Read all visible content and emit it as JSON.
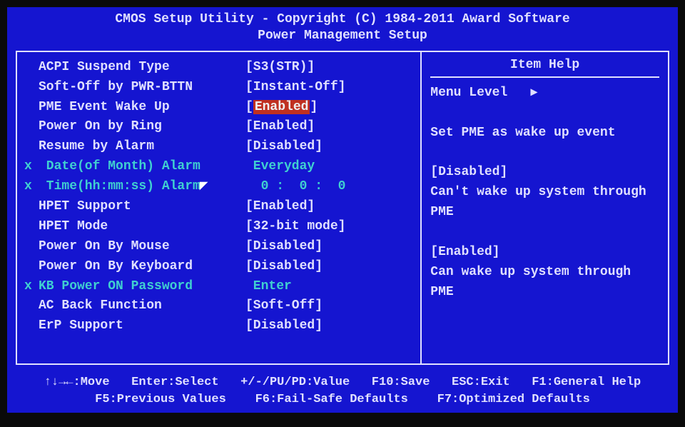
{
  "header": {
    "title": "CMOS Setup Utility - Copyright (C) 1984-2011 Award Software",
    "subtitle": "Power Management Setup"
  },
  "settings": [
    {
      "label": "ACPI Suspend Type",
      "value": "[S3(STR)]",
      "disabled": false,
      "selected": false
    },
    {
      "label": "Soft-Off by PWR-BTTN",
      "value": "[Instant-Off]",
      "disabled": false,
      "selected": false
    },
    {
      "label": "PME Event Wake Up",
      "value_open": "[",
      "value_inner": "Enabled",
      "value_close": "]",
      "disabled": false,
      "selected": true
    },
    {
      "label": "Power On by Ring",
      "value": "[Enabled]",
      "disabled": false,
      "selected": false
    },
    {
      "label": "Resume by Alarm",
      "value": "[Disabled]",
      "disabled": false,
      "selected": false
    },
    {
      "label": " Date(of Month) Alarm",
      "value": " Everyday",
      "disabled": true,
      "selected": false
    },
    {
      "label": " Time(hh:mm:ss) Alarm",
      "value": "  0 :  0 :  0",
      "disabled": true,
      "selected": false
    },
    {
      "label": "HPET Support",
      "value": "[Enabled]",
      "disabled": false,
      "selected": false
    },
    {
      "label": "HPET Mode",
      "value": "[32-bit mode]",
      "disabled": false,
      "selected": false
    },
    {
      "label": "Power On By Mouse",
      "value": "[Disabled]",
      "disabled": false,
      "selected": false
    },
    {
      "label": "Power On By Keyboard",
      "value": "[Disabled]",
      "disabled": false,
      "selected": false
    },
    {
      "label": "KB Power ON Password",
      "value": " Enter",
      "disabled": true,
      "selected": false
    },
    {
      "label": "AC Back Function",
      "value": "[Soft-Off]",
      "disabled": false,
      "selected": false
    },
    {
      "label": "ErP Support",
      "value": "[Disabled]",
      "disabled": false,
      "selected": false
    }
  ],
  "help": {
    "title": "Item Help",
    "lines": [
      "Menu Level   ▸",
      "",
      "Set PME as wake up event",
      "",
      "[Disabled]",
      "Can't wake up system through PME",
      "",
      "[Enabled]",
      "Can wake up system through PME"
    ]
  },
  "footer": {
    "row1": "↑↓→←:Move   Enter:Select   +/-/PU/PD:Value   F10:Save   ESC:Exit   F1:General Help",
    "row2": "F5:Previous Values    F6:Fail-Safe Defaults    F7:Optimized Defaults"
  }
}
